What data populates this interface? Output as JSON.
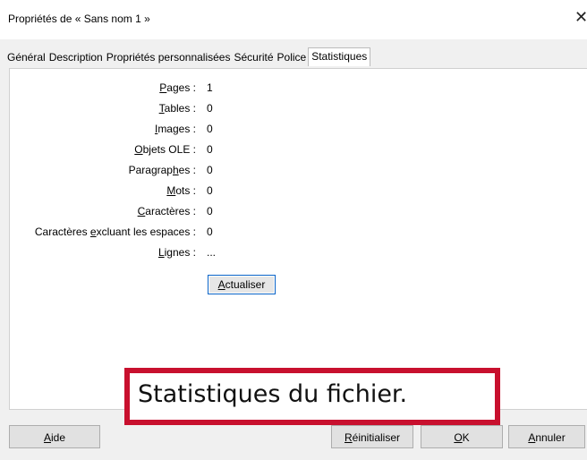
{
  "window": {
    "title": "Propriétés de « Sans nom 1 »",
    "close_glyph": "✕"
  },
  "tabs": [
    {
      "label": "Général",
      "active": false
    },
    {
      "label": "Description",
      "active": false
    },
    {
      "label": "Propriétés personnalisées",
      "active": false
    },
    {
      "label": "Sécurité",
      "active": false
    },
    {
      "label": "Police",
      "active": false
    },
    {
      "label": "Statistiques",
      "active": true
    }
  ],
  "stats": [
    {
      "label_pre": "",
      "label_key": "P",
      "label_post": "ages :",
      "value": "1"
    },
    {
      "label_pre": "",
      "label_key": "T",
      "label_post": "ables :",
      "value": "0"
    },
    {
      "label_pre": "",
      "label_key": "I",
      "label_post": "mages :",
      "value": "0"
    },
    {
      "label_pre": "",
      "label_key": "O",
      "label_post": "bjets OLE :",
      "value": "0"
    },
    {
      "label_pre": "Paragrap",
      "label_key": "h",
      "label_post": "es :",
      "value": "0"
    },
    {
      "label_pre": "",
      "label_key": "M",
      "label_post": "ots :",
      "value": "0"
    },
    {
      "label_pre": "",
      "label_key": "C",
      "label_post": "aractères :",
      "value": "0"
    },
    {
      "label_pre": "Caractères ",
      "label_key": "e",
      "label_post": "xcluant les espaces :",
      "value": "0"
    },
    {
      "label_pre": "",
      "label_key": "L",
      "label_post": "ignes :",
      "value": "..."
    }
  ],
  "refresh_button": {
    "label_key": "A",
    "label_post": "ctualiser"
  },
  "annotation": {
    "text": "Statistiques du fichier."
  },
  "footer": {
    "help": {
      "label_key": "A",
      "label_post": "ide"
    },
    "reset": {
      "label_key": "R",
      "label_post": "éinitialiser"
    },
    "ok": {
      "label_key": "O",
      "label_post": "K"
    },
    "cancel": {
      "label_key": "A",
      "label_post": "nnuler"
    }
  }
}
